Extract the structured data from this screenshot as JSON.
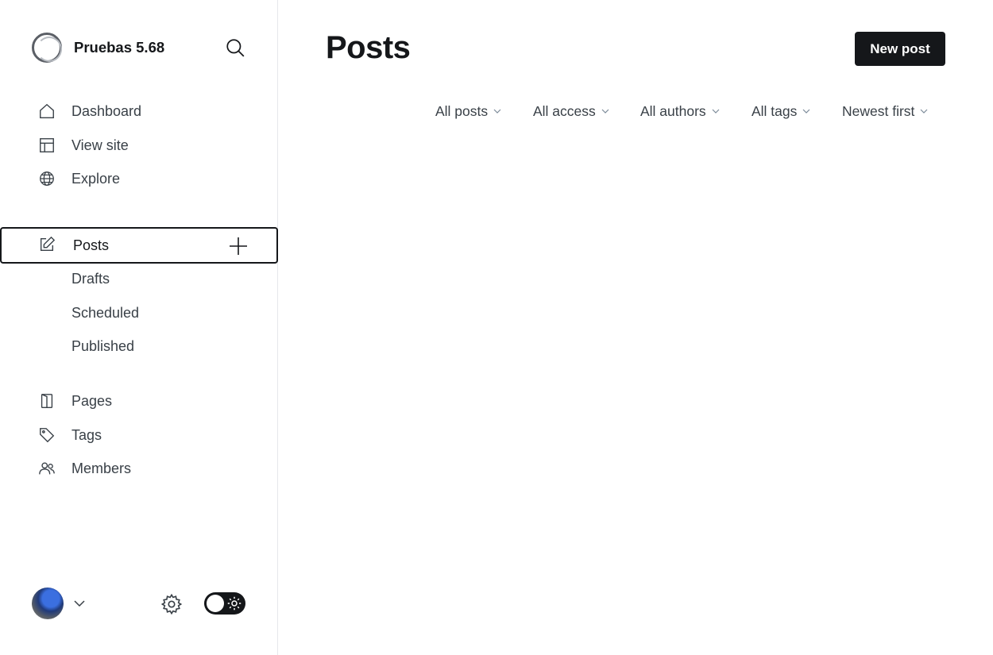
{
  "brand": {
    "name": "Pruebas 5.68",
    "logo_icon": "ghost-ring-logo"
  },
  "sidebar": {
    "primary": [
      {
        "label": "Dashboard",
        "icon": "home-icon"
      },
      {
        "label": "View site",
        "icon": "layout-icon"
      },
      {
        "label": "Explore",
        "icon": "globe-icon"
      }
    ],
    "posts": {
      "label": "Posts",
      "icon": "edit-icon",
      "sub": [
        {
          "label": "Drafts"
        },
        {
          "label": "Scheduled"
        },
        {
          "label": "Published"
        }
      ]
    },
    "secondary": [
      {
        "label": "Pages",
        "icon": "page-icon"
      },
      {
        "label": "Tags",
        "icon": "tag-icon"
      },
      {
        "label": "Members",
        "icon": "members-icon"
      }
    ]
  },
  "main": {
    "title": "Posts",
    "new_post_label": "New post",
    "filters": [
      {
        "label": "All posts"
      },
      {
        "label": "All access"
      },
      {
        "label": "All authors"
      },
      {
        "label": "All tags"
      },
      {
        "label": "Newest first"
      }
    ]
  },
  "colors": {
    "primary": "#15171a",
    "text": "#394047",
    "border": "#e6e8eb"
  }
}
